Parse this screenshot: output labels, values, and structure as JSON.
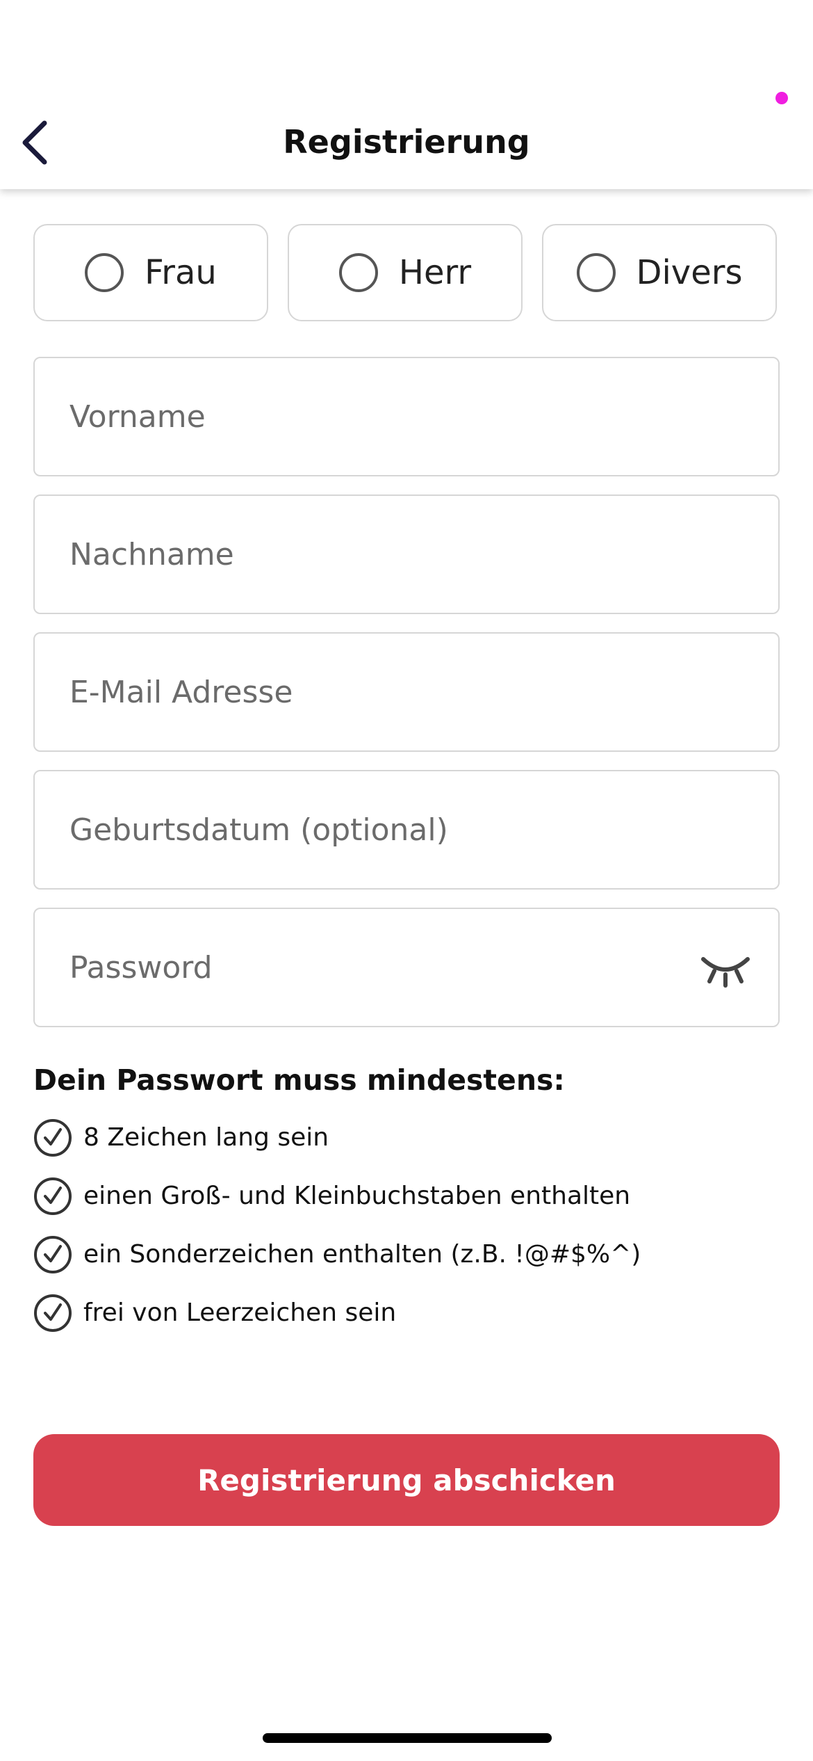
{
  "header": {
    "title": "Registrierung",
    "back_icon": "chevron-left-icon",
    "status_dot_color": "#f01ee0"
  },
  "gender": {
    "options": [
      {
        "label": "Frau",
        "selected": false
      },
      {
        "label": "Herr",
        "selected": false
      },
      {
        "label": "Divers",
        "selected": false
      }
    ]
  },
  "form": {
    "first_name": {
      "placeholder": "Vorname",
      "value": ""
    },
    "last_name": {
      "placeholder": "Nachname",
      "value": ""
    },
    "email": {
      "placeholder": "E-Mail Adresse",
      "value": ""
    },
    "birthdate": {
      "placeholder": "Geburtsdatum (optional)",
      "value": ""
    },
    "password": {
      "placeholder": "Password",
      "value": "",
      "toggle_icon": "eye-closed-icon"
    }
  },
  "password_rules": {
    "title": "Dein Passwort muss mindestens:",
    "items": [
      "8 Zeichen lang sein",
      "einen Groß- und Kleinbuchstaben enthalten",
      "ein Sonderzeichen enthalten (z.B. !@#$%^)",
      "frei von Leerzeichen sein"
    ],
    "icon": "check-circle-icon"
  },
  "submit": {
    "label": "Registrierung abschicken",
    "color": "#d8414f"
  }
}
